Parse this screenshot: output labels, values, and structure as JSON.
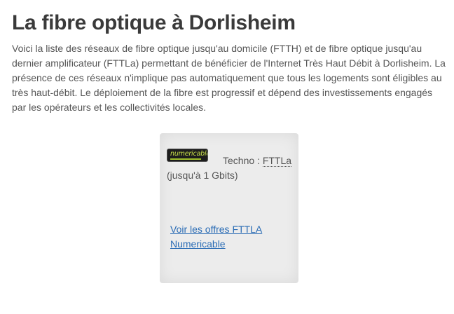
{
  "page": {
    "title": "La fibre optique à Dorlisheim",
    "intro": "Voici la liste des réseaux de fibre optique jusqu'au domicile (FTTH) et de fibre optique jusqu'au dernier amplificateur (FTTLa) permettant de bénéficier de l'Internet Très Haut Débit à Dorlisheim. La présence de ces réseaux n'implique pas automatiquement que tous les logements sont éligibles au très haut-débit. Le déploiement de la fibre est progressif et dépend des investissements engagés par les opérateurs et les collectivités locales."
  },
  "card": {
    "logo_text": "numericable",
    "logo_icon": "numericable-logo",
    "techno_label": "Techno : ",
    "techno_value": "FTTLa",
    "techno_detail": " (jusqu'à 1 Gbits)",
    "offer_link": "Voir les offres FTTLA Numericable"
  },
  "colors": {
    "title": "#3a3a3a",
    "text": "#555555",
    "link": "#2a6cb5",
    "card_background": "#ececec"
  }
}
